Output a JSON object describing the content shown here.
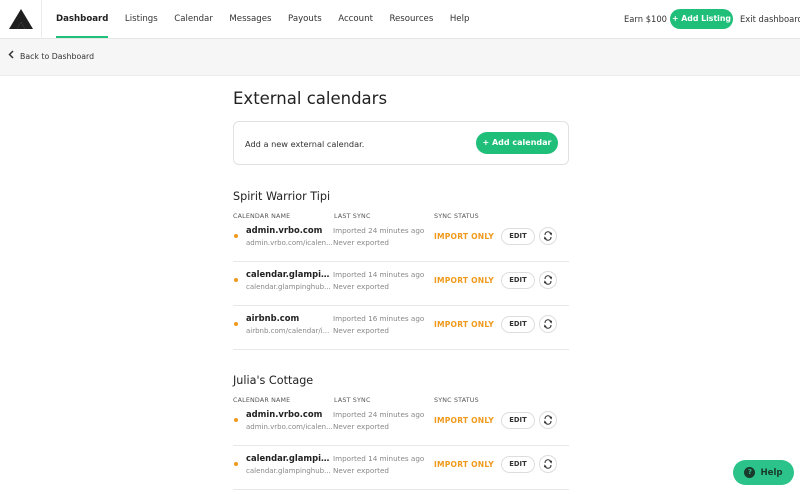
{
  "nav": {
    "items": [
      {
        "label": "Dashboard",
        "active": true
      },
      {
        "label": "Listings",
        "active": false
      },
      {
        "label": "Calendar",
        "active": false
      },
      {
        "label": "Messages",
        "active": false
      },
      {
        "label": "Payouts",
        "active": false
      },
      {
        "label": "Account",
        "active": false
      },
      {
        "label": "Resources",
        "active": false
      },
      {
        "label": "Help",
        "active": false
      }
    ],
    "earn": "Earn $100",
    "add_listing": "+ Add Listing",
    "exit": "Exit dashboard"
  },
  "subbar": {
    "back": "Back to Dashboard"
  },
  "main": {
    "title": "External calendars",
    "add_box_text": "Add a new external calendar.",
    "add_calendar_button": "+ Add calendar",
    "columns": [
      "CALENDAR NAME",
      "LAST SYNC",
      "SYNC STATUS"
    ],
    "edit_label": "EDIT"
  },
  "sections": [
    {
      "title": "Spirit Warrior Tipi",
      "rows": [
        {
          "name": "admin.vrbo.com",
          "url": "admin.vrbo.com/icalen...",
          "sync1": "Imported 24 minutes ago",
          "sync2": "Never exported",
          "status": "IMPORT ONLY"
        },
        {
          "name": "calendar.glampingh...",
          "url": "calendar.glampinghub...",
          "sync1": "Imported 14 minutes ago",
          "sync2": "Never exported",
          "status": "IMPORT ONLY"
        },
        {
          "name": "airbnb.com",
          "url": "airbnb.com/calendar/i...",
          "sync1": "Imported 16 minutes ago",
          "sync2": "Never exported",
          "status": "IMPORT ONLY"
        }
      ]
    },
    {
      "title": "Julia's Cottage",
      "rows": [
        {
          "name": "admin.vrbo.com",
          "url": "admin.vrbo.com/icalen...",
          "sync1": "Imported 24 minutes ago",
          "sync2": "Never exported",
          "status": "IMPORT ONLY"
        },
        {
          "name": "calendar.glampingh...",
          "url": "calendar.glampinghub...",
          "sync1": "Imported 14 minutes ago",
          "sync2": "Never exported",
          "status": "IMPORT ONLY"
        }
      ]
    }
  ],
  "help": {
    "label": "Help",
    "icon": "?"
  },
  "colors": {
    "accent": "#1fbf79",
    "status": "#ef9a1d",
    "help": "#2bc38a"
  }
}
